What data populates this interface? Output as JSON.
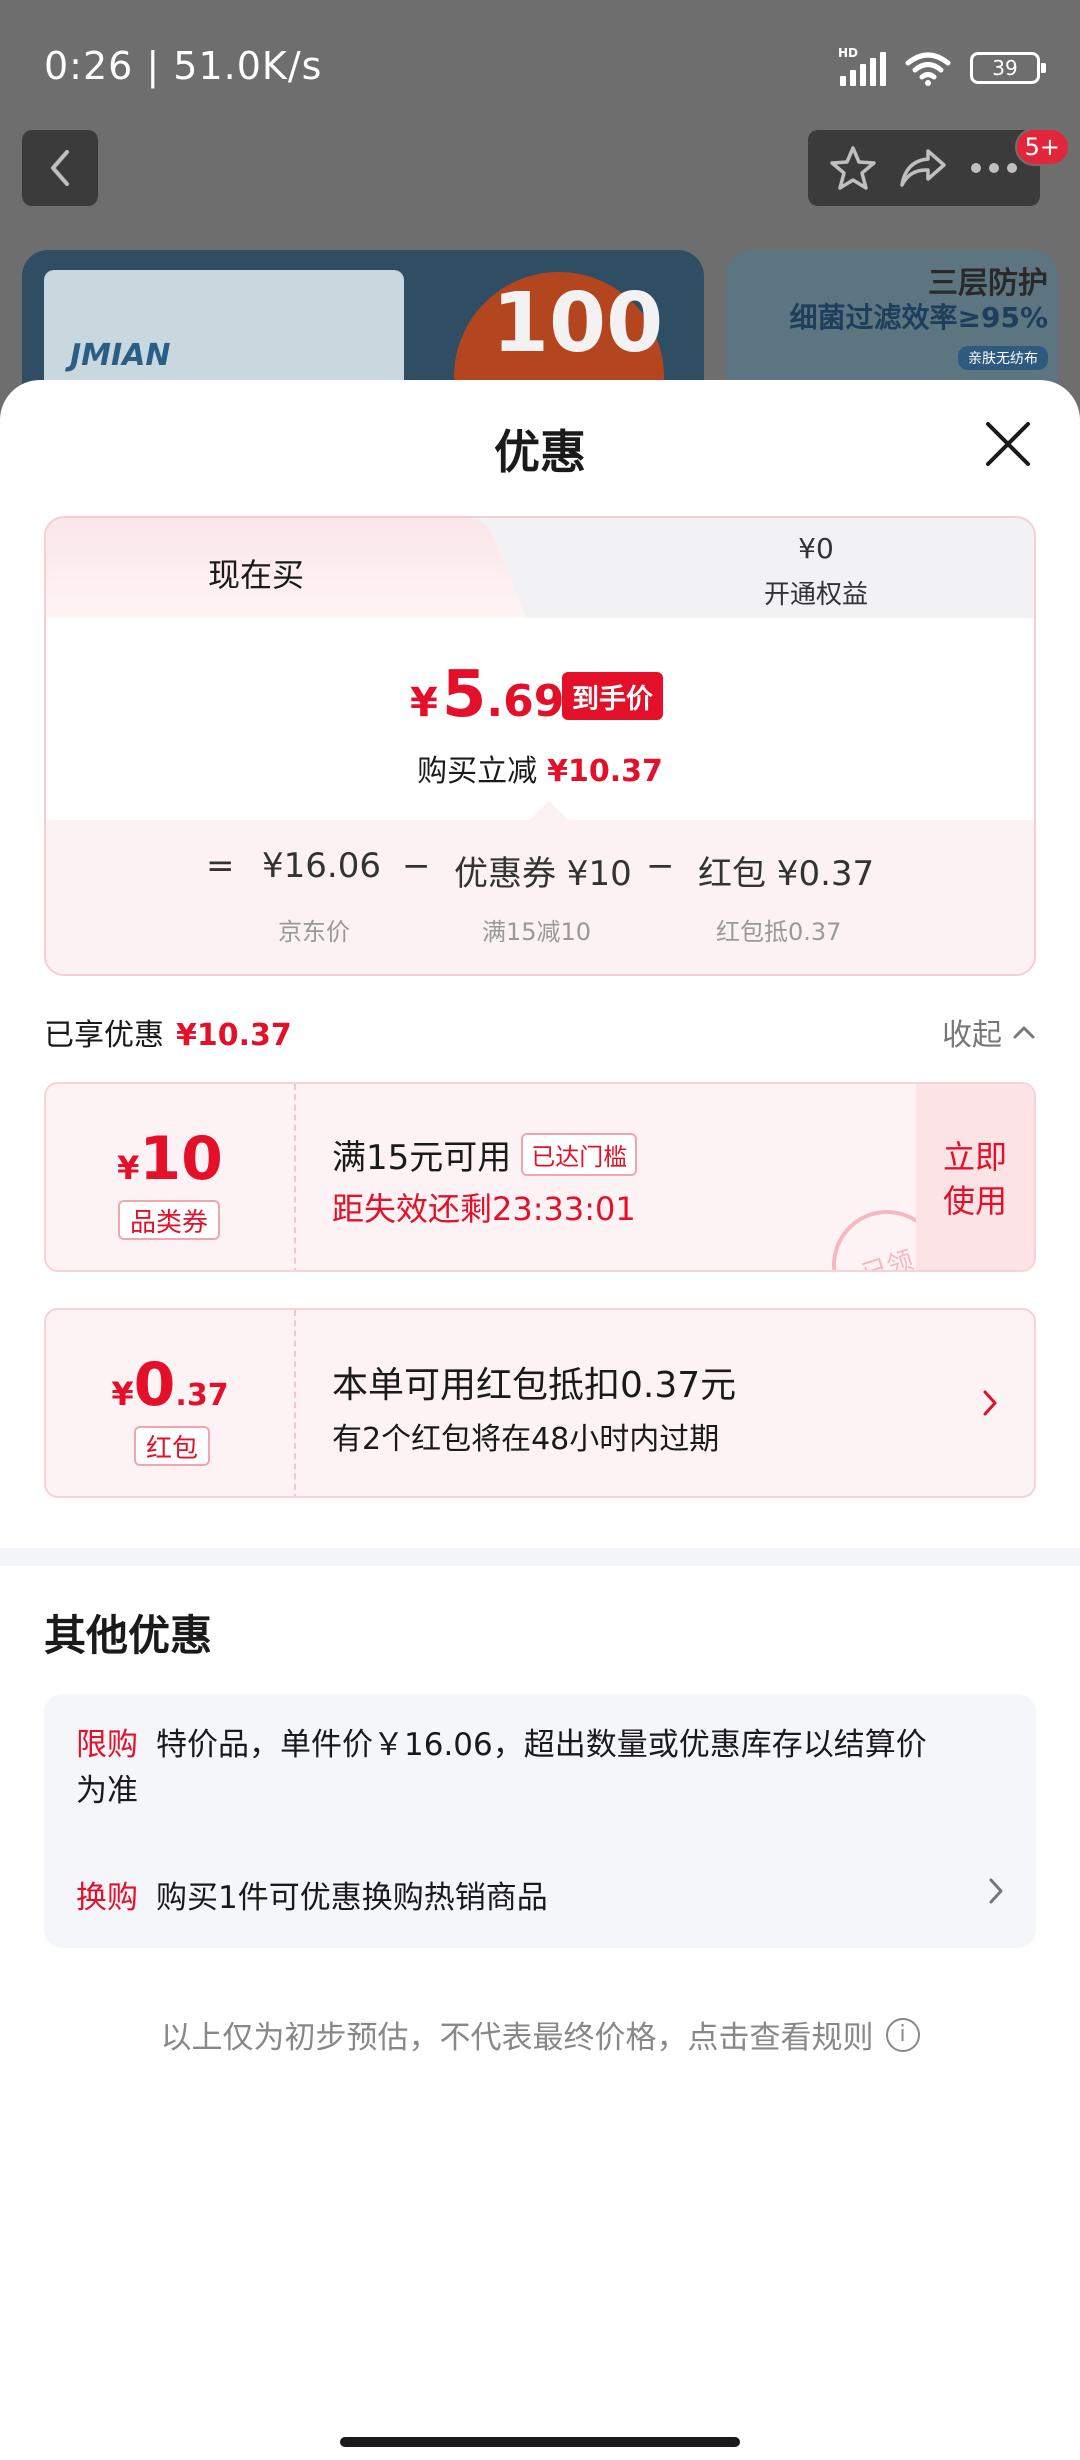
{
  "status_bar": {
    "time_speed": "0:26 | 51.0K/s",
    "network_tag": "HD",
    "battery": "39"
  },
  "background": {
    "badge": "5+",
    "brand": "JMIAN",
    "pack_count": "100",
    "promo_line1": "三层防护",
    "promo_line2": "细菌过滤效率≥95%",
    "promo_line3": "亲肤无纺布"
  },
  "sheet": {
    "title": "优惠"
  },
  "price_card": {
    "tab_active": "现在买",
    "tab_inactive_price": "¥0",
    "tab_inactive_label": "开通权益",
    "final_price": {
      "yen": "¥",
      "int": "5",
      "dec": ".69"
    },
    "final_tag": "到手价",
    "reduce_label": "购买立减",
    "reduce_amount": "¥10.37",
    "breakdown": {
      "eq": "=",
      "jd_price": "¥16.06",
      "minus": "−",
      "coupon": "优惠券 ¥10",
      "redpack": "红包 ¥0.37",
      "jd_price_sub": "京东价",
      "coupon_sub": "满15减10",
      "redpack_sub": "红包抵0.37"
    }
  },
  "enjoyed": {
    "label": "已享优惠",
    "amount": "¥10.37",
    "collapse": "收起"
  },
  "coupon_card": {
    "yen": "¥",
    "value": "10",
    "type": "品类券",
    "condition": "满15元可用",
    "reached_tag": "已达门槛",
    "countdown": "距失效还剩23:33:01",
    "use_now_l1": "立即",
    "use_now_l2": "使用",
    "stamp": "已领"
  },
  "redpack_card": {
    "yen": "¥",
    "value_int": "0",
    "value_dec": ".37",
    "type": "红包",
    "line1": "本单可用红包抵扣0.37元",
    "line2": "有2个红包将在48小时内过期"
  },
  "other_offers": {
    "title": "其他优惠",
    "offer1_tag": "限购",
    "offer1_text": "特价品，单件价￥16.06，超出数量或优惠库存以结算价为准",
    "offer2_tag": "换购",
    "offer2_text": "购买1件可优惠换购热销商品"
  },
  "footnote": "以上仅为初步预估，不代表最终价格，点击查看规则",
  "colors": {
    "accent_red": "#e4102a",
    "overlay_gray": "#6e6e6e"
  }
}
